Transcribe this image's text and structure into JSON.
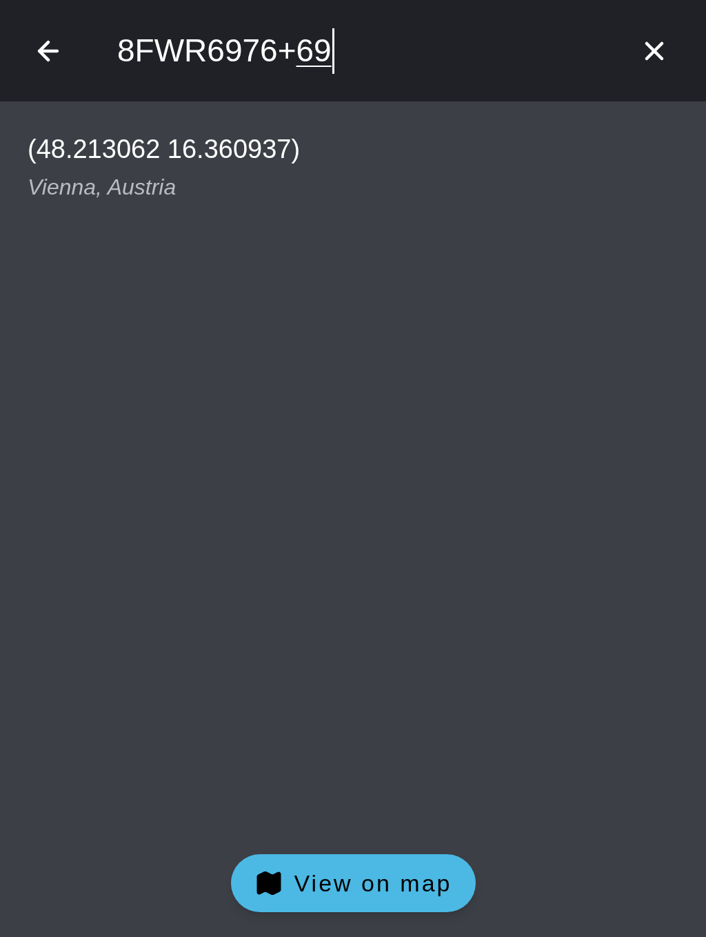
{
  "search": {
    "value": "8FWR6976+",
    "composing": "69"
  },
  "results": [
    {
      "title": "(48.213062 16.360937)",
      "subtitle": "Vienna, Austria"
    }
  ],
  "map_button": {
    "label": "View on map"
  }
}
